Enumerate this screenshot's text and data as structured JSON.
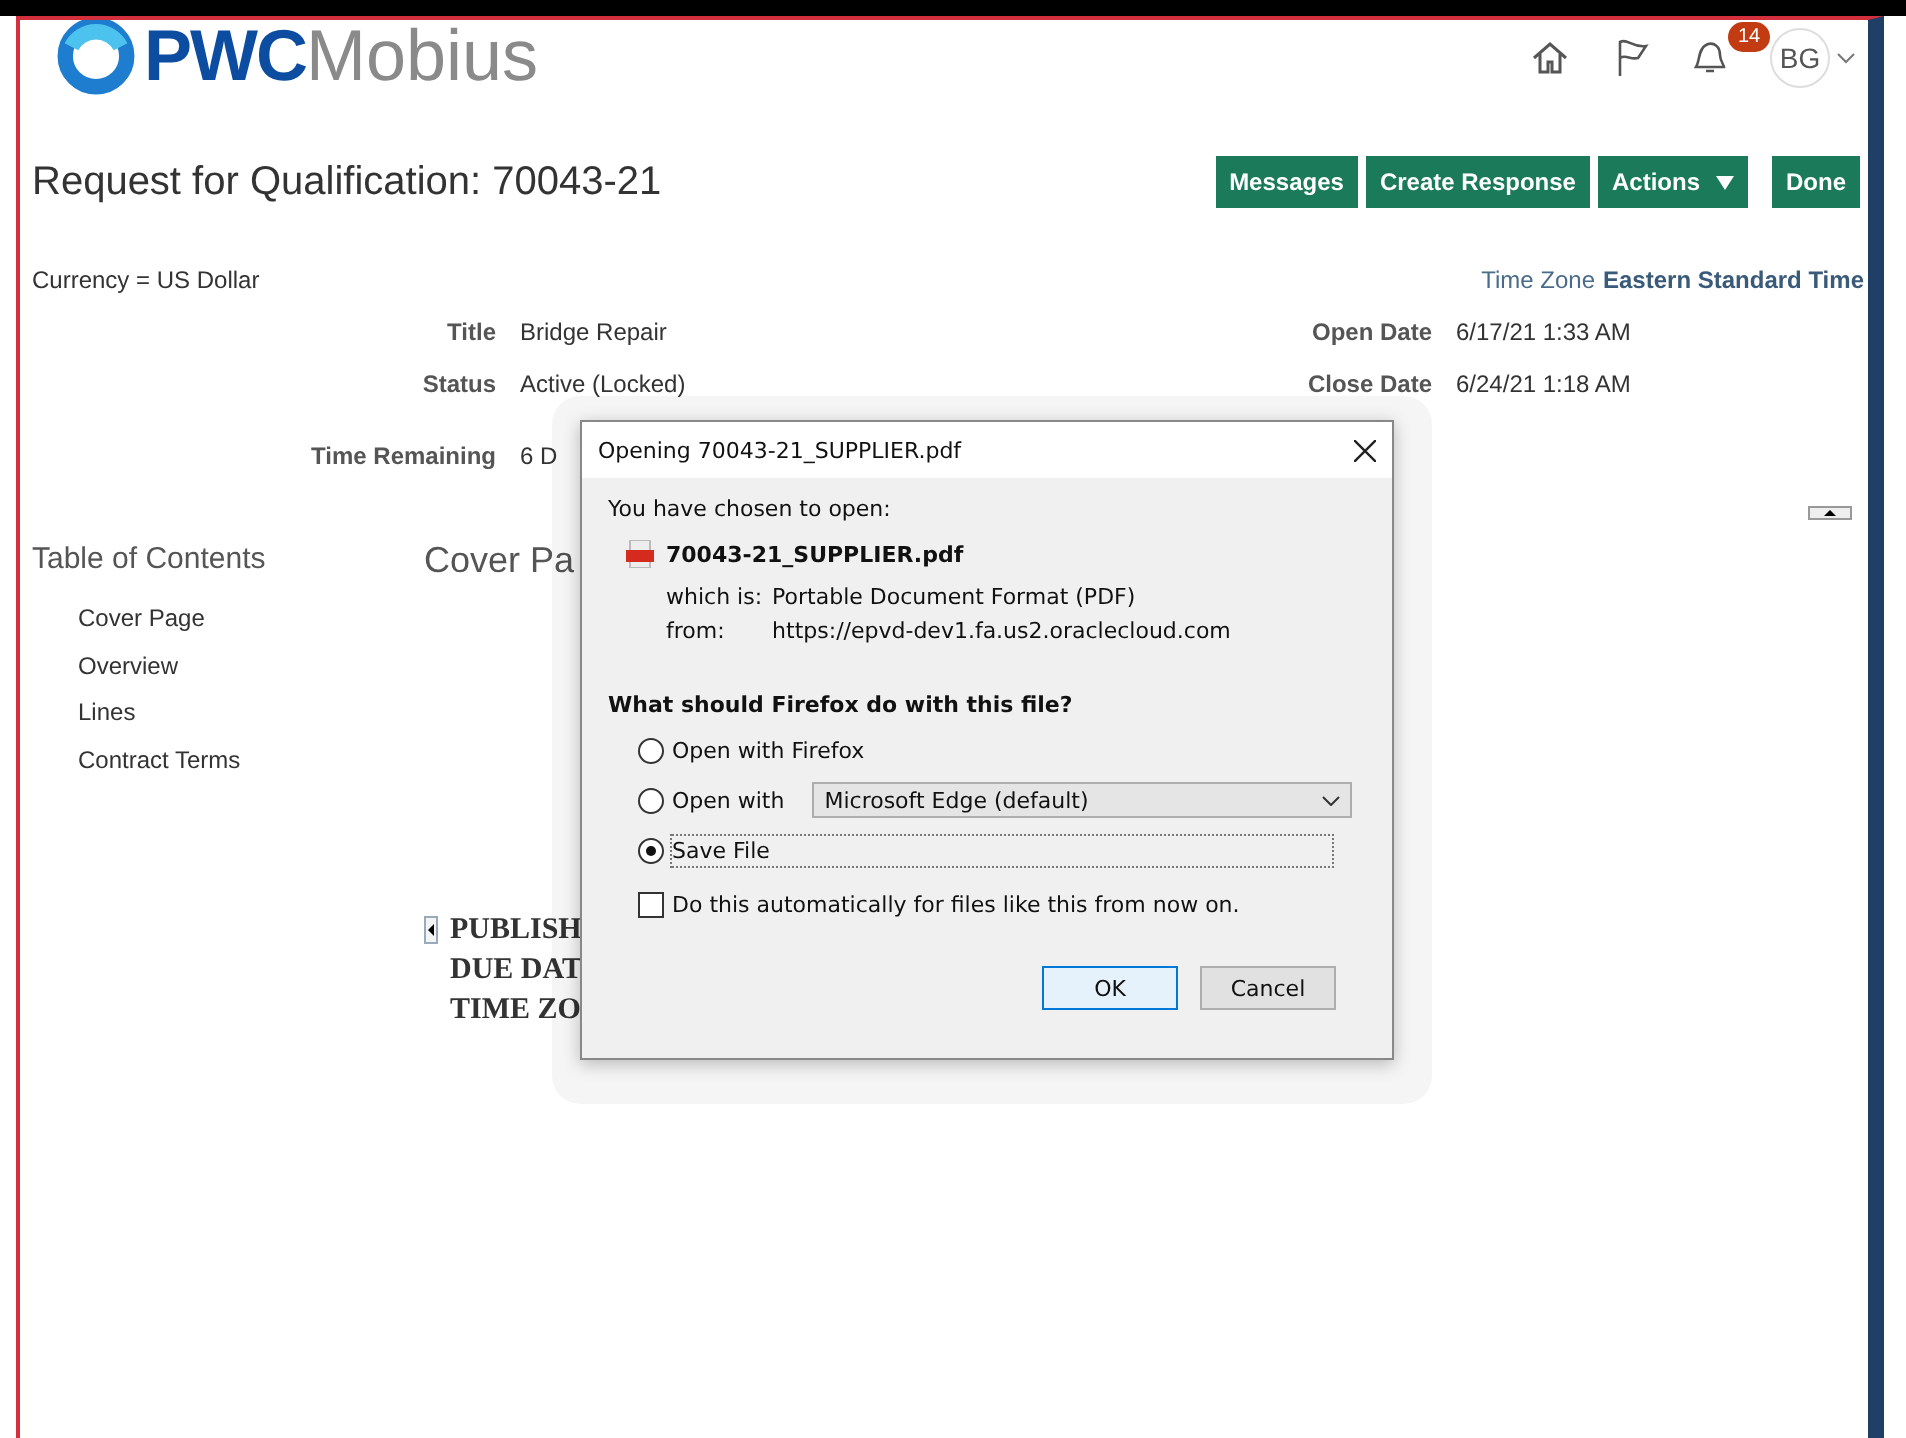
{
  "header": {
    "logo": {
      "brand": "PWC",
      "product": "Mobius"
    },
    "notifications": {
      "count": "14"
    },
    "user": {
      "initials": "BG"
    }
  },
  "page": {
    "title": "Request for Qualification: 70043-21",
    "buttons": [
      {
        "label": "Messages",
        "kind": "plain"
      },
      {
        "label": "Create Response",
        "kind": "plain"
      },
      {
        "label": "Actions",
        "kind": "menu"
      },
      {
        "label": "Done",
        "kind": "plain"
      }
    ],
    "currency": "Currency = US Dollar",
    "time_zone": {
      "label": "Time Zone",
      "value": "Eastern Standard Time"
    },
    "fields_left": [
      {
        "label": "Title",
        "value": "Bridge Repair"
      },
      {
        "label": "Status",
        "value": "Active (Locked)"
      }
    ],
    "fields_right": [
      {
        "label": "Open Date",
        "value": "6/17/21 1:33 AM"
      },
      {
        "label": "Close Date",
        "value": "6/24/21 1:18 AM"
      }
    ],
    "time_remaining": {
      "label": "Time Remaining",
      "value": "6 D"
    },
    "toc": {
      "title": "Table of Contents",
      "items": [
        "Cover Page",
        "Overview",
        "Lines",
        "Contract Terms"
      ]
    },
    "section_title": "Cover Pa",
    "document_lines": [
      "PUBLISH",
      "DUE DAT",
      "TIME ZO"
    ]
  },
  "dialog": {
    "title": "Opening 70043-21_SUPPLIER.pdf",
    "intro": "You have chosen to open:",
    "file_name": "70043-21_SUPPLIER.pdf",
    "which_is": {
      "label": "which is:",
      "value": "Portable Document Format (PDF)"
    },
    "from": {
      "label": "from:",
      "value": "https://epvd-dev1.fa.us2.oraclecloud.com"
    },
    "question": "What should Firefox do with this file?",
    "options": [
      {
        "label": "Open with Firefox",
        "selected": false,
        "kind": "plain"
      },
      {
        "label": "Open with",
        "selected": false,
        "kind": "select",
        "select_value": "Microsoft Edge (default)"
      },
      {
        "label": "Save File",
        "selected": true,
        "kind": "focused"
      }
    ],
    "auto_checkbox": {
      "label": "Do this automatically for files like this from now on.",
      "checked": false
    },
    "buttons": [
      {
        "label": "OK",
        "kind": "default"
      },
      {
        "label": "Cancel",
        "kind": "normal"
      }
    ]
  }
}
